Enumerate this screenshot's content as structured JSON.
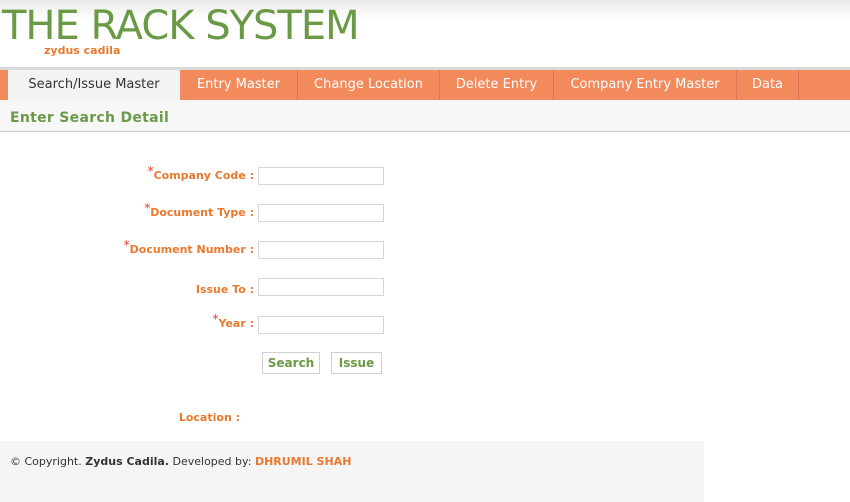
{
  "header": {
    "title": "THE RACK SYSTEM",
    "subtitle": "zydus cadila"
  },
  "nav": {
    "items": [
      {
        "label": "Search/Issue Master",
        "active": true
      },
      {
        "label": "Entry Master",
        "active": false
      },
      {
        "label": "Change Location",
        "active": false
      },
      {
        "label": "Delete Entry",
        "active": false
      },
      {
        "label": "Company Entry Master",
        "active": false
      },
      {
        "label": "Data",
        "active": false
      }
    ]
  },
  "section": {
    "title": "Enter Search Detail"
  },
  "form": {
    "required_mark": "*",
    "company_code_label": "Company Code :",
    "company_code_value": "",
    "document_type_label": "Document Type :",
    "document_type_value": "",
    "document_number_label": "Document Number :",
    "document_number_value": "",
    "issue_to_label": "Issue To :",
    "issue_to_value": "",
    "year_label": "Year :",
    "year_value": "",
    "search_button": "Search",
    "issue_button": "Issue",
    "location_label": "Location :"
  },
  "footer": {
    "copyright_prefix": "© Copyright.",
    "company": "Zydus Cadila.",
    "developed_by": "Developed by:",
    "developer": "DHRUMIL SHAH"
  },
  "colors": {
    "brand_green": "#6b9a47",
    "accent_orange": "#e8792e",
    "nav_orange": "#f28a5c",
    "required_red": "#e83a2e"
  }
}
